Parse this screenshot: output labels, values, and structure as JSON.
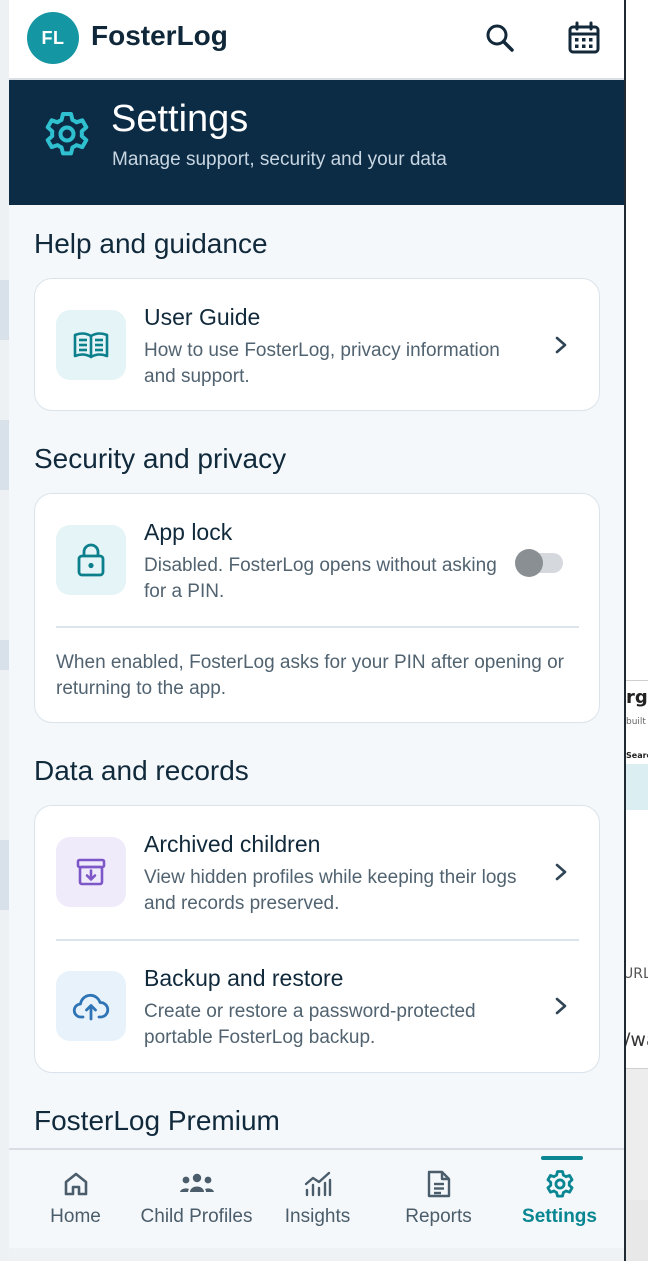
{
  "app": {
    "avatar_initials": "FL",
    "title": "FosterLog",
    "accent_color": "#0a8592",
    "header_color": "#0c2b45"
  },
  "topbar_icons": [
    "search-icon",
    "calendar-icon"
  ],
  "hero": {
    "title": "Settings",
    "subtitle": "Manage support, security and your data",
    "icon": "gear-icon"
  },
  "sections": {
    "help": {
      "title": "Help and guidance",
      "user_guide": {
        "title": "User Guide",
        "description": "How to use FosterLog, privacy information and support.",
        "icon": "book-icon"
      }
    },
    "security": {
      "title": "Security and privacy",
      "app_lock": {
        "title": "App lock",
        "description": "Disabled. FosterLog opens without asking for a PIN.",
        "enabled": false,
        "icon": "lock-icon",
        "note": "When enabled, FosterLog asks for your PIN after opening or returning to the app."
      }
    },
    "data": {
      "title": "Data and records",
      "archived": {
        "title": "Archived children",
        "description": "View hidden profiles while keeping their logs and records preserved.",
        "icon": "archive-icon"
      },
      "backup": {
        "title": "Backup and restore",
        "description": "Create or restore a password-protected portable FosterLog backup.",
        "icon": "cloud-upload-icon"
      }
    },
    "premium": {
      "title": "FosterLog Premium"
    }
  },
  "nav": {
    "items": [
      {
        "label": "Home",
        "icon": "home-icon"
      },
      {
        "label": "Child Profiles",
        "icon": "people-icon"
      },
      {
        "label": "Insights",
        "icon": "insights-icon"
      },
      {
        "label": "Reports",
        "icon": "report-icon"
      },
      {
        "label": "Settings",
        "icon": "gear-icon"
      }
    ],
    "active": "Settings"
  },
  "background_window": {
    "fragments": [
      "rga",
      "built f",
      "Searc",
      "URL",
      "/wa"
    ]
  }
}
